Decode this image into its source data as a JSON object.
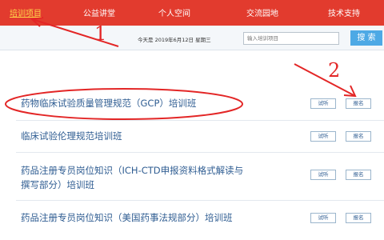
{
  "nav": {
    "items": [
      {
        "label": "培训项目",
        "active": true
      },
      {
        "label": "公益讲堂"
      },
      {
        "label": "个人空间"
      },
      {
        "label": "交流园地"
      },
      {
        "label": "技术支持"
      }
    ]
  },
  "subbar": {
    "date_text": "今天是 2019年6月12日 星期三",
    "search_placeholder": "输入培训项目",
    "search_button": "搜 索"
  },
  "courses": [
    {
      "title": "药物临床试验质量管理规范（GCP）培训班",
      "btn1": "试听",
      "btn2": "报名"
    },
    {
      "title": "临床试验伦理规范培训班",
      "btn1": "试听",
      "btn2": "报名"
    },
    {
      "title_line1": "药品注册专员岗位知识（ICH-CTD申报资料格式解读与",
      "title_line2": "撰写部分）培训班",
      "btn1": "试听",
      "btn2": "报名"
    },
    {
      "title": "药品注册专员岗位知识（美国药事法规部分）培训班",
      "btn1": "试听",
      "btn2": "报名"
    }
  ],
  "annotations": {
    "label1": "1",
    "label2": "2"
  },
  "colors": {
    "nav_bg": "#e23b2e",
    "link": "#2f5d92",
    "annotation": "#e32626",
    "search_btn": "#4da9e5"
  }
}
